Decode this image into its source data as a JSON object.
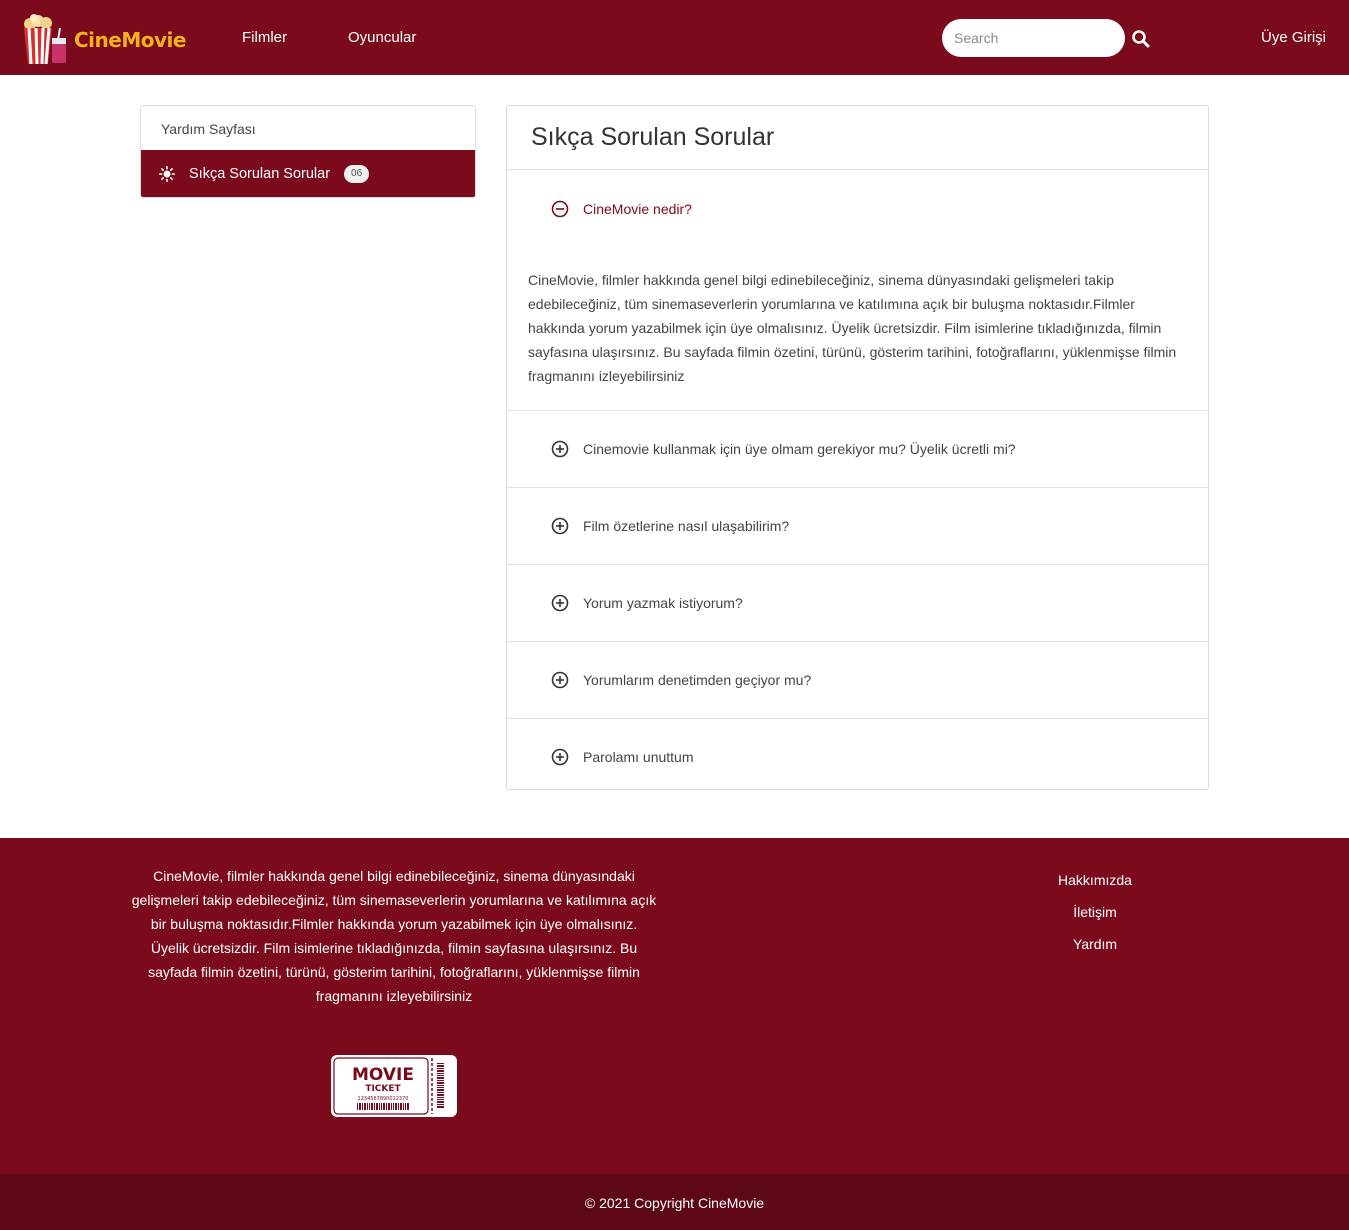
{
  "brand": {
    "name": "CineMovie",
    "logo_icon": "popcorn-logo-icon",
    "accent": "#f5b21b",
    "primary": "#7a0a1c"
  },
  "nav": {
    "links": [
      "Filmler",
      "Oyuncular"
    ],
    "search_placeholder": "Search",
    "search_icon": "search-icon",
    "login_label": "Üye Girişi"
  },
  "sidebar": {
    "heading": "Yardım Sayfası",
    "items": [
      {
        "label": "Sıkça Sorulan Sorular",
        "count": "06",
        "icon": "sun-icon"
      }
    ]
  },
  "faq": {
    "title": "Sıkça Sorulan Sorular",
    "items": [
      {
        "question": "CineMovie nedir?",
        "open": true,
        "answer": "CineMovie, filmler hakkında genel bilgi edinebileceğiniz, sinema dünyasındaki gelişmeleri takip edebileceğiniz, tüm sinemaseverlerin yorumlarına ve katılımına açık bir buluşma noktasıdır.Filmler hakkında yorum yazabilmek için üye olmalısınız. Üyelik ücretsizdir. Film isimlerine tıkladığınızda, filmin sayfasına ulaşırsınız. Bu sayfada filmin özetini, türünü, gösterim tarihini, fotoğraflarını, yüklenmişse filmin fragmanını izleyebilirsiniz"
      },
      {
        "question": "Cinemovie kullanmak için üye olmam gerekiyor mu? Üyelik ücretli mi?",
        "open": false
      },
      {
        "question": "Film özetlerine nasıl ulaşabilirim?",
        "open": false
      },
      {
        "question": "Yorum yazmak istiyorum?",
        "open": false
      },
      {
        "question": "Yorumlarım denetimden geçiyor mu?",
        "open": false
      },
      {
        "question": "Parolamı unuttum",
        "open": false
      }
    ]
  },
  "footer": {
    "about": "CineMovie, filmler hakkında genel bilgi edinebileceğiniz, sinema dünyasındaki gelişmeleri takip edebileceğiniz, tüm sinemaseverlerin yorumlarına ve katılımına açık bir buluşma noktasıdır.Filmler hakkında yorum yazabilmek için üye olmalısınız. Üyelik ücretsizdir. Film isimlerine tıkladığınızda, filmin sayfasına ulaşırsınız. Bu sayfada filmin özetini, türünü, gösterim tarihini, fotoğraflarını, yüklenmişse filmin fragmanını izleyebilirsiniz",
    "links": [
      "Hakkımızda",
      "İletişim",
      "Yardım"
    ],
    "ticket": {
      "line1": "MOVIE",
      "line2": "TICKET",
      "barcode": "1234567890012370"
    },
    "copyright": "© 2021 Copyright CineMovie"
  }
}
